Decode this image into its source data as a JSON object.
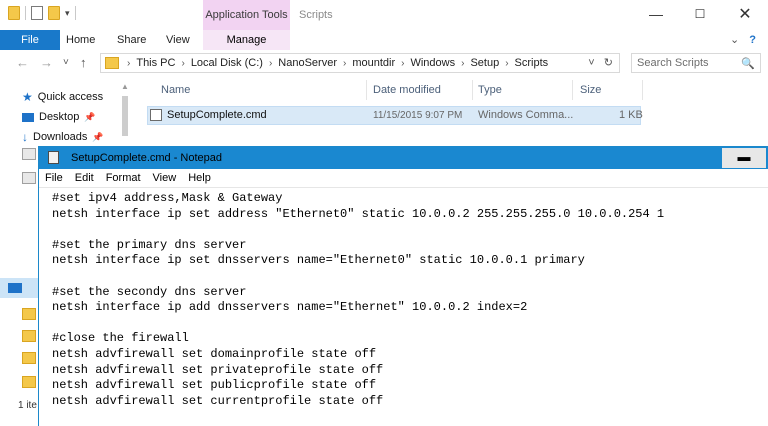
{
  "explorer": {
    "titlebar": {
      "context_tab": "Application Tools",
      "window_title": "Scripts",
      "minimize": "—",
      "maximize": "☐",
      "close": "✕"
    },
    "ribbon": {
      "file": "File",
      "tabs": [
        "Home",
        "Share",
        "View"
      ],
      "manage": "Manage"
    },
    "address": {
      "back": "←",
      "forward": "→",
      "recent": "˅",
      "up": "↑",
      "crumbs": [
        "This PC",
        "Local Disk (C:)",
        "NanoServer",
        "mountdir",
        "Windows",
        "Setup",
        "Scripts"
      ],
      "sep": "›",
      "dropdown": "˅",
      "refresh": "↻"
    },
    "search": {
      "placeholder": "Search Scripts",
      "icon": "🔍"
    },
    "nav": {
      "items": [
        {
          "label": "Quick access",
          "icon": "star-icon"
        },
        {
          "label": "Desktop",
          "icon": "desktop-icon"
        },
        {
          "label": "Downloads",
          "icon": "download-icon"
        }
      ]
    },
    "columns": [
      "Name",
      "Date modified",
      "Type",
      "Size"
    ],
    "files": [
      {
        "name": "SetupComplete.cmd",
        "date": "11/15/2015 9:07 PM",
        "type": "Windows Comma...",
        "size": "1 KB"
      }
    ],
    "status": {
      "count": "1 ite"
    }
  },
  "notepad": {
    "title": "SetupComplete.cmd - Notepad",
    "minimize": "▬",
    "menu": [
      "File",
      "Edit",
      "Format",
      "View",
      "Help"
    ],
    "content": "#set ipv4 address,Mask & Gateway\nnetsh interface ip set address \"Ethernet0\" static 10.0.0.2 255.255.255.0 10.0.0.254 1\n\n#set the primary dns server\nnetsh interface ip set dnsservers name=\"Ethernet0\" static 10.0.0.1 primary\n\n#set the secondy dns server\nnetsh interface ip add dnsservers name=\"Ethernet\" 10.0.0.2 index=2\n\n#close the firewall\nnetsh advfirewall set domainprofile state off\nnetsh advfirewall set privateprofile state off\nnetsh advfirewall set publicprofile state off\nnetsh advfirewall set currentprofile state off"
  }
}
